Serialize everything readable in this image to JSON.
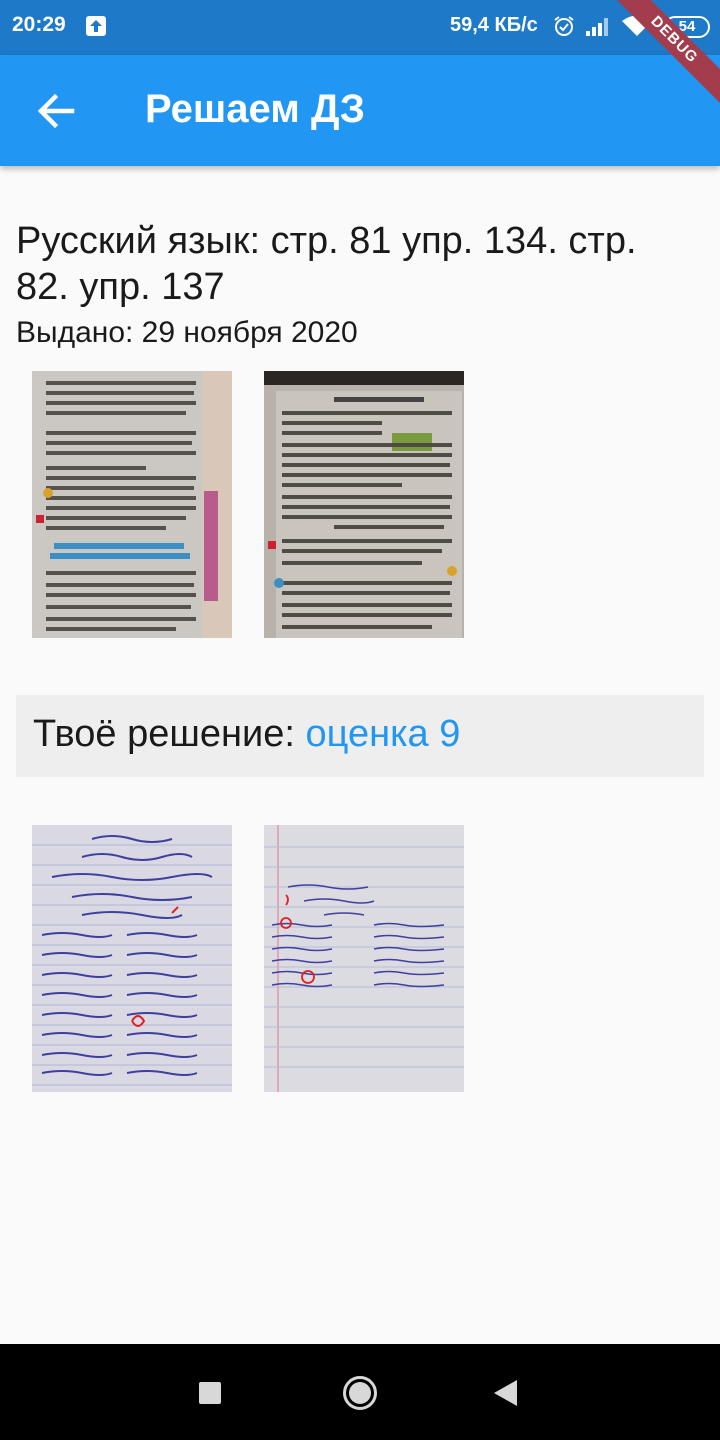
{
  "status_bar": {
    "time": "20:29",
    "net_speed": "59,4 КБ/с",
    "battery": "54",
    "debug_label": "DEBUG"
  },
  "app_bar": {
    "title": "Решаем ДЗ",
    "back_icon": "arrow-left-icon"
  },
  "task": {
    "title": "Русский язык: стр. 81 упр. 134. стр. 82. упр. 137",
    "issued": "Выдано: 29 ноября 2020"
  },
  "solution": {
    "label": "Твоё решение: ",
    "grade": "оценка 9"
  },
  "colors": {
    "primary": "#2196f3",
    "status_bar": "#1e7ac8",
    "debug_ribbon": "#a33d4d"
  }
}
